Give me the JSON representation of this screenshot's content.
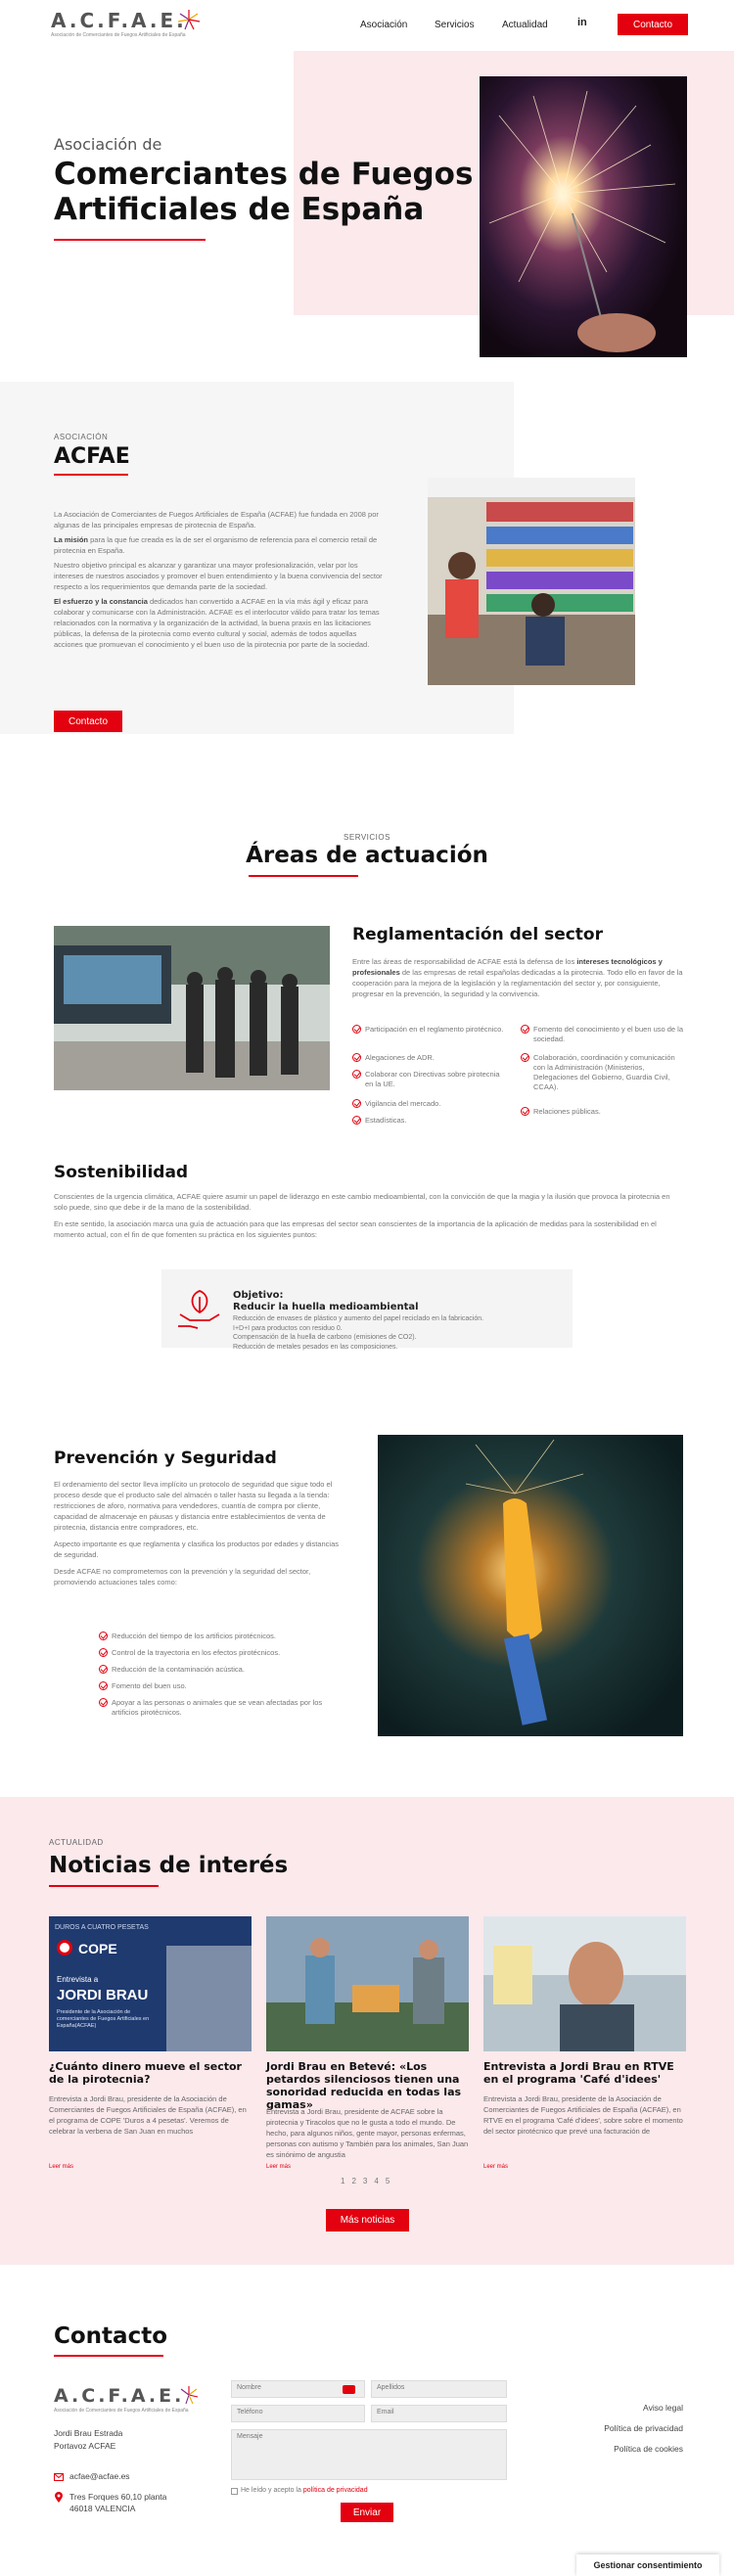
{
  "header": {
    "logo": "A.C.F.A.E.",
    "logo_sub": "Asociación de Comerciantes de Fuegos Artificiales de España",
    "nav": [
      "Asociación",
      "Servicios",
      "Actualidad"
    ],
    "linkedin": "in",
    "contact_button": "Contacto"
  },
  "hero": {
    "kicker": "Asociación de",
    "title_line1": "Comerciantes de Fuegos",
    "title_line2": "Artificiales de España"
  },
  "about": {
    "label": "ASOCIACIÓN",
    "title": "ACFAE",
    "p1": "La Asociación de Comerciantes de Fuegos Artificiales de España (ACFAE) fue fundada en 2008 por algunas de las principales empresas de pirotecnia de España.",
    "p2_strong": "La misión",
    "p2": " para la que fue creada es la de ser el organismo de referencia para el comercio retail de pirotecnia en España.",
    "p3": "Nuestro objetivo principal es alcanzar y garantizar una mayor profesionalización, velar por los intereses de nuestros asociados y promover el buen entendimiento y la buena convivencia del sector respecto a los requerimientos que demanda parte de la sociedad.",
    "p4_strong": "El esfuerzo y la constancia",
    "p4": " dedicados han convertido a ACFAE en la vía más ágil y eficaz para colaborar y comunicarse con la Administración. ACFAE es el interlocutor válido para tratar los temas relacionados con la normativa y la organización de la actividad, la buena praxis en las licitaciones públicas, la defensa de la pirotecnia como evento cultural y social, además de todos aquellas acciones que promuevan el conocimiento y el buen uso de la pirotecnia por parte de la sociedad.",
    "button": "Contacto"
  },
  "services": {
    "label": "SERVICIOS",
    "title": "Áreas de actuación"
  },
  "regulation": {
    "title": "Reglamentación del sector",
    "text_a": "Entre las áreas de responsabilidad de ACFAE está la defensa de los ",
    "text_strong": "intereses tecnológicos y profesionales",
    "text_b": " de las empresas de retail españolas dedicadas a la pirotecnia. Todo ello en favor de la cooperación para la mejora de la legislación y la reglamentación del sector y, por consiguiente, progresar en la prevención, la seguridad y la convivencia.",
    "items_left": [
      "Participación en el reglamento pirotécnico.",
      "Alegaciones de ADR.",
      "Colaborar con Directivas sobre pirotecnia en la UE.",
      "Vigilancia del mercado.",
      "Estadísticas."
    ],
    "items_right": [
      "Fomento del conocimiento y el buen uso de la sociedad.",
      "Colaboración, coordinación y comunicación con la Administración (Ministerios, Delegaciones del Gobierno, Guardia Civil, CCAA).",
      "Relaciones públicas."
    ]
  },
  "sustainability": {
    "title": "Sostenibilidad",
    "p1": "Conscientes de la urgencia climática, ACFAE quiere asumir un papel de liderazgo en este cambio medioambiental, con la convicción de que la magia y la ilusión que provoca la pirotecnia en solo puede, sino que debe ir de la mano de la sostenibilidad.",
    "p2": "En este sentido, la asociación marca una guía de actuación para que las empresas del sector sean conscientes de la importancia de la aplicación de medidas para la sostenibilidad en el momento actual, con el fin de que fomenten su práctica en los siguientes puntos:",
    "objective_label": "Objetivo:",
    "objective_title": "Reducir la huella medioambiental",
    "objective_lines": [
      "Reducción de envases de plástico y aumento del papel reciclado en la fabricación.",
      "I+D+I para productos con residuo 0.",
      "Compensación de la huella de carbono (emisiones de CO2).",
      "Reducción de metales pesados en las composiciones."
    ]
  },
  "prevention": {
    "title": "Prevención y Seguridad",
    "p1": "El ordenamiento del sector lleva implícito un protocolo de seguridad que sigue todo el proceso desde que el producto sale del almacén o taller hasta su llegada a la tienda: restricciones de aforo, normativa para vendedores, cuantía de compra por cliente, capacidad de almacenaje en páusas y distancia entre establecimientos de venta de pirotecnia, distancia entre compradores, etc.",
    "p2": "Aspecto importante es que reglamenta y clasifica los productos por edades y distancias de seguridad.",
    "p3": "Desde ACFAE no comprometemos con la prevención y la seguridad del sector, promoviendo actuaciones tales como:",
    "items": [
      "Reducción del tiempo de los artificios pirotécnicos.",
      "Control de la trayectoria en los efectos pirotécnicos.",
      "Reducción de la contaminación acústica.",
      "Fomento del buen uso.",
      "Apoyar a las personas o animales que se vean afectadas por los artificios pirotécnicos."
    ]
  },
  "news": {
    "label": "ACTUALIDAD",
    "title": "Noticias de interés",
    "cards": [
      {
        "title": "¿Cuánto dinero mueve el sector de la pirotecnia?",
        "text": "Entrevista a Jordi Brau, presidente de la Asociación de Comerciantes de Fuegos Artificiales de España (ACFAE), en el programa de COPE 'Duros a 4 pesetas'. Veremos de celebrar la verbena de San Juan en muchos",
        "more": "Leer más",
        "img_kicker": "DUROS A CUATRO PESETAS",
        "img_brand": "COPE",
        "img_line1": "Entrevista a",
        "img_name": "JORDI BRAU",
        "img_line2": "Presidente de la Asociación de comerciantes de Fuegos Artificiales en España(ACFAE)"
      },
      {
        "title": "Jordi Brau en Betevé: «Los petardos silenciosos tienen una sonoridad reducida en todas las gamas»",
        "text": "Entrevista a Jordi Brau, presidente de ACFAE sobre la pirotecnia y Tiracolos que no le gusta a todo el mundo. De hecho, para algunos niños, gente mayor, personas enfermas, personas con autismo y También para los animales, San Juan es sinónimo de angustia",
        "more": "Leer más"
      },
      {
        "title": "Entrevista a Jordi Brau en RTVE en el programa 'Café d'idees'",
        "text": "Entrevista a Jordi Brau, presidente de la Asociación de Comerciantes de Fuegos Artificiales de España (ACFAE), en RTVE en el programa 'Café d'idees', sobre sobre el momento del sector pirotécnico que prevé una facturación de",
        "more": "Leer más"
      }
    ],
    "pagination": [
      "1",
      "2",
      "3",
      "4",
      "5"
    ],
    "more_button": "Más noticias"
  },
  "contact": {
    "title": "Contacto",
    "logo": "A.C.F.A.E.",
    "logo_sub": "Asociación de Comerciantes de Fuegos Artificiales de España",
    "person": "Jordi Brau Estrada",
    "role": "Portavoz ACFAE",
    "email": "acfae@acfae.es",
    "address1": "Tres Forques 60,10 planta",
    "address2": "46018 VALENCIA",
    "placeholders": {
      "nombre": "Nombre",
      "apellidos": "Apellidos",
      "telefono": "Teléfono",
      "email": "Email",
      "mensaje": "Mensaje"
    },
    "privacy_a": "He leído y acepto la ",
    "privacy_link": "política de privacidad",
    "submit": "Enviar",
    "legal_links": [
      "Aviso legal",
      "Política de privacidad",
      "Política de cookies"
    ]
  },
  "cookie_button": "Gestionar consentimiento",
  "colors": {
    "accent": "#e3000f",
    "pink": "#fbe9ec",
    "grey_bg": "#f6f6f6"
  }
}
